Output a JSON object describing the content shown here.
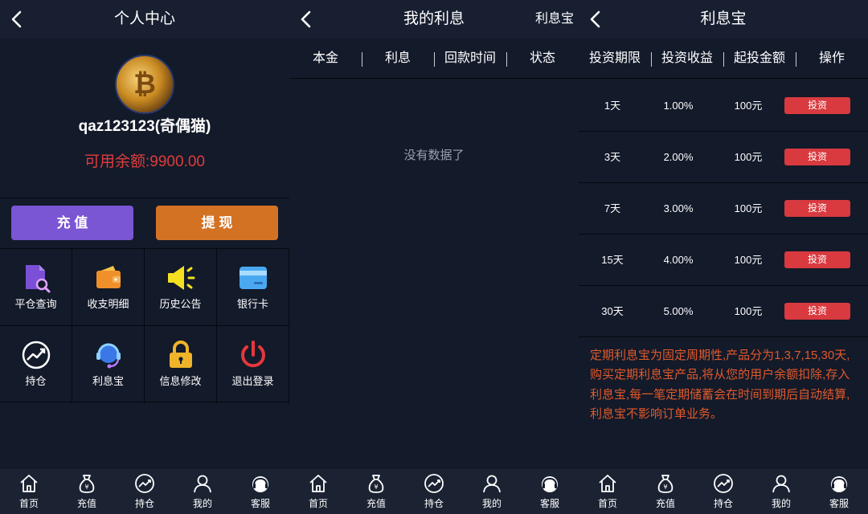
{
  "profile": {
    "title": "个人中心",
    "username": "qaz123123(奇偶猫)",
    "balance_label": "可用余额:",
    "balance_value": "9900.00",
    "recharge_label": "充 值",
    "withdraw_label": "提 现",
    "menu": [
      {
        "label": "平仓查询",
        "icon": "document-search-icon"
      },
      {
        "label": "收支明细",
        "icon": "wallet-icon"
      },
      {
        "label": "历史公告",
        "icon": "megaphone-icon"
      },
      {
        "label": "银行卡",
        "icon": "bank-card-icon"
      },
      {
        "label": "持仓",
        "icon": "trend-chart-icon"
      },
      {
        "label": "利息宝",
        "icon": "headset-icon"
      },
      {
        "label": "信息修改",
        "icon": "lock-icon"
      },
      {
        "label": "退出登录",
        "icon": "power-icon"
      }
    ]
  },
  "interest": {
    "title": "我的利息",
    "extra_link": "利息宝",
    "columns": [
      "本金",
      "利息",
      "回款时间",
      "状态"
    ],
    "empty_text": "没有数据了"
  },
  "lixibao": {
    "title": "利息宝",
    "columns": [
      "投资期限",
      "投资收益",
      "起投金额",
      "操作"
    ],
    "rows": [
      {
        "term": "1天",
        "rate": "1.00%",
        "min": "100元",
        "action": "投资"
      },
      {
        "term": "3天",
        "rate": "2.00%",
        "min": "100元",
        "action": "投资"
      },
      {
        "term": "7天",
        "rate": "3.00%",
        "min": "100元",
        "action": "投资"
      },
      {
        "term": "15天",
        "rate": "4.00%",
        "min": "100元",
        "action": "投资"
      },
      {
        "term": "30天",
        "rate": "5.00%",
        "min": "100元",
        "action": "投资"
      }
    ],
    "description": "定期利息宝为固定周期性,产品分为1,3,7,15,30天,购买定期利息宝产品,将从您的用户余额扣除,存入利息宝,每一笔定期储蓄会在时间到期后自动结算,利息宝不影响订单业务。"
  },
  "tabs": [
    {
      "label": "首页",
      "icon": "home-icon"
    },
    {
      "label": "充值",
      "icon": "money-bag-icon"
    },
    {
      "label": "持仓",
      "icon": "trend-chart-icon"
    },
    {
      "label": "我的",
      "icon": "user-icon"
    },
    {
      "label": "客服",
      "icon": "customer-service-icon"
    }
  ],
  "colors": {
    "background": "#131a2a",
    "recharge": "#7a56d4",
    "withdraw": "#d47224",
    "balance": "#e03c3c",
    "invest": "#d83a3f",
    "description": "#e0592a"
  }
}
